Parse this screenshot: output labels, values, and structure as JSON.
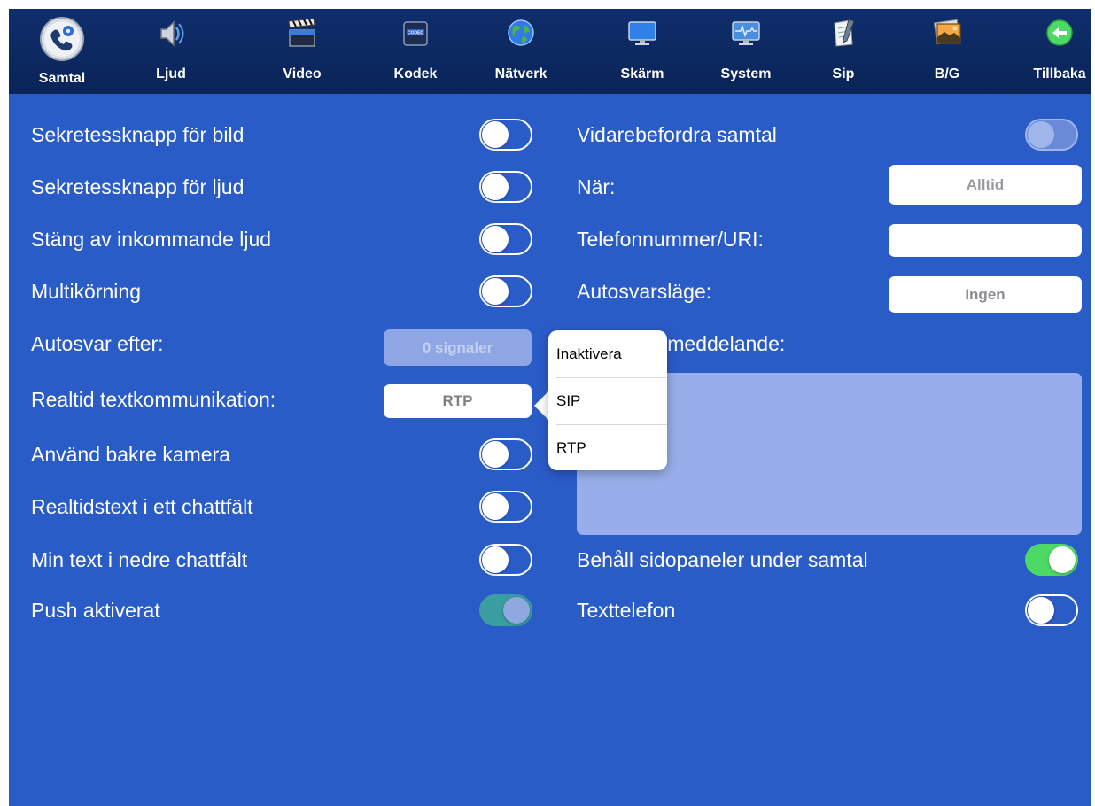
{
  "toolbar": {
    "items": [
      {
        "label": "Samtal",
        "icon": "phone-gear-icon",
        "active": true
      },
      {
        "label": "Ljud",
        "icon": "speaker-icon"
      },
      {
        "label": "Video",
        "icon": "clapperboard-icon"
      },
      {
        "label": "Kodek",
        "icon": "codec-chip-icon"
      },
      {
        "label": "Nätverk",
        "icon": "globe-icon"
      },
      {
        "label": "Skärm",
        "icon": "monitor-icon"
      },
      {
        "label": "System",
        "icon": "system-monitor-icon"
      },
      {
        "label": "Sip",
        "icon": "notepad-icon"
      },
      {
        "label": "B/G",
        "icon": "picture-icon"
      },
      {
        "label": "Tillbaka",
        "icon": "back-arrow-icon"
      }
    ],
    "codec_icon_text": "CODEC"
  },
  "left": {
    "rows": [
      {
        "label": "Sekretessknapp för bild",
        "toggle": "off"
      },
      {
        "label": "Sekretessknapp för ljud",
        "toggle": "off"
      },
      {
        "label": "Stäng av inkommande ljud",
        "toggle": "off"
      },
      {
        "label": "Multikörning",
        "toggle": "off"
      },
      {
        "label": "Autosvar efter:",
        "button": "0 signaler",
        "disabled": true
      },
      {
        "label": "Realtid textkommunikation:",
        "button": "RTP"
      },
      {
        "label": "Använd bakre kamera",
        "toggle": "off"
      },
      {
        "label": "Realtidstext i ett chattfält",
        "toggle": "off"
      },
      {
        "label": "Min text i nedre chattfält",
        "toggle": "off"
      },
      {
        "label": "Push aktiverat",
        "toggle": "on",
        "disabled": true
      }
    ]
  },
  "right": {
    "forward_label": "Vidarebefordra samtal",
    "forward_toggle": "off",
    "when_label": "När:",
    "when_value": "Alltid",
    "phone_label": "Telefonnummer/URI:",
    "phone_value": "",
    "autoanswer_mode_label": "Autosvarsläge:",
    "autoanswer_mode_value": "Ingen",
    "message_label": "Autosvarsmeddelande:",
    "message_value": "",
    "keep_panels_label": "Behåll sidopaneler under samtal",
    "keep_panels_toggle": "on",
    "texttelephone_label": "Texttelefon",
    "texttelephone_toggle": "off"
  },
  "popover": {
    "options": [
      "Inaktivera",
      "SIP",
      "RTP"
    ]
  },
  "colors": {
    "background": "#2a5cc8",
    "toolbar": "#0f2e6c",
    "toggle_on": "#4cd964",
    "back_button": "#4cd964"
  }
}
